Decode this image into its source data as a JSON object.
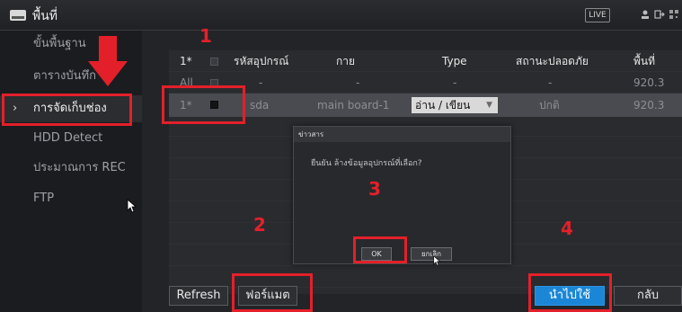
{
  "topbar": {
    "title": "พื้นที่",
    "live_label": "LIVE"
  },
  "sidebar": {
    "items": [
      {
        "label": "ขั้นพื้นฐาน"
      },
      {
        "label": "ตารางบันทึก"
      },
      {
        "label": "การจัดเก็บช่อง",
        "active": true
      },
      {
        "label": "HDD Detect"
      },
      {
        "label": "ประมาณการ REC"
      },
      {
        "label": "FTP"
      }
    ]
  },
  "table": {
    "headers": [
      "1*",
      "รหัสอุปกรณ์",
      "กาย",
      "Type",
      "สถานะปลอดภัย",
      "พื้นที่"
    ],
    "all_row": {
      "id": "All",
      "device": "-",
      "physical": "-",
      "type": "-",
      "status": "-",
      "space": "920.3"
    },
    "selected_row": {
      "id": "1*",
      "device": "sda",
      "physical": "main board-1",
      "type": "อ่าน / เขียน",
      "status": "ปกติ",
      "space": "920.3"
    }
  },
  "dialog": {
    "title": "ข่าวสาร",
    "message": "ยืนยัน ล้างข้อมูลอุปกรณ์ที่เลือก?",
    "ok_label": "OK",
    "cancel_label": "ยกเลิก"
  },
  "footer": {
    "refresh_label": "Refresh",
    "format_label": "ฟอร์แมต",
    "apply_label": "นำไปใช้",
    "back_label": "กลับ"
  },
  "annotations": [
    "1",
    "2",
    "3",
    "4"
  ],
  "colors": {
    "highlight": "#e3202a",
    "primary": "#1b86d6"
  }
}
